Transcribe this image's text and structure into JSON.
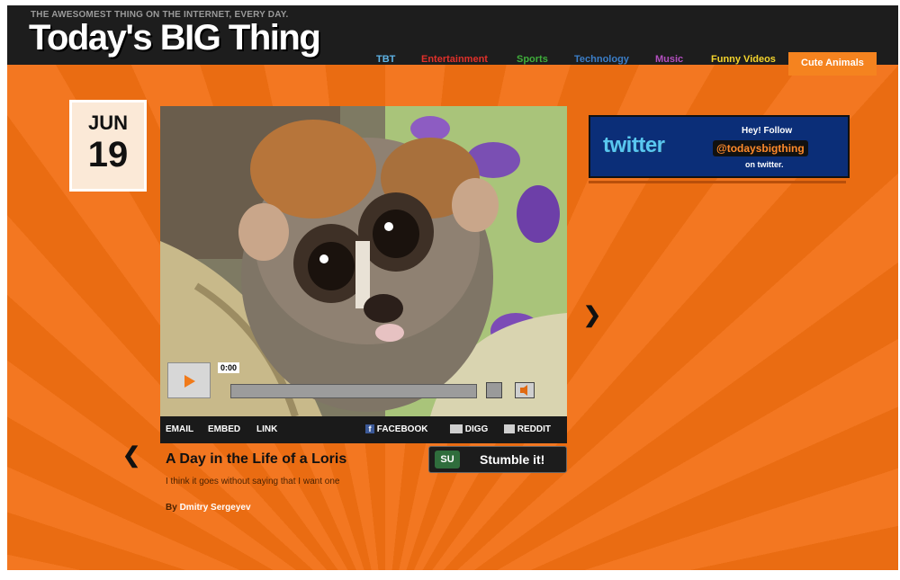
{
  "header": {
    "tagline": "THE AWESOMEST THING ON THE INTERNET, EVERY DAY.",
    "logo": "Today's BIG Thing"
  },
  "nav": {
    "items": [
      {
        "label": "TBT",
        "color": "#5fb4e6"
      },
      {
        "label": "Entertainment",
        "color": "#e0302a"
      },
      {
        "label": "Sports",
        "color": "#3fae3b"
      },
      {
        "label": "Technology",
        "color": "#3b7ec8"
      },
      {
        "label": "Music",
        "color": "#b34fbf"
      },
      {
        "label": "Funny Videos",
        "color": "#f5d52c"
      },
      {
        "label": "Cute Animals",
        "color": "#ffffff",
        "active": true
      }
    ]
  },
  "date": {
    "month": "JUN",
    "day": "19"
  },
  "video": {
    "time": "0:00",
    "progress": 0,
    "share": {
      "email": "EMAIL",
      "embed": "EMBED",
      "link": "LINK",
      "facebook": "FACEBOOK",
      "digg": "DIGG",
      "reddit": "REDDIT"
    }
  },
  "article": {
    "title": "A Day in the Life of a Loris",
    "excerpt": "I think it goes without saying that I want one",
    "byline_prefix": "By",
    "author": "Dmitry Sergeyev"
  },
  "stumble": {
    "badge": "SU",
    "label": "Stumble it!"
  },
  "twitter": {
    "logo": "twitter",
    "hey": "Hey! Follow",
    "handle": "@todaysbigthing",
    "on": "on twitter."
  },
  "colors": {
    "page_bg": "#f26f13",
    "header_bg": "#1d1d1d",
    "active_tab": "#f5831f"
  }
}
